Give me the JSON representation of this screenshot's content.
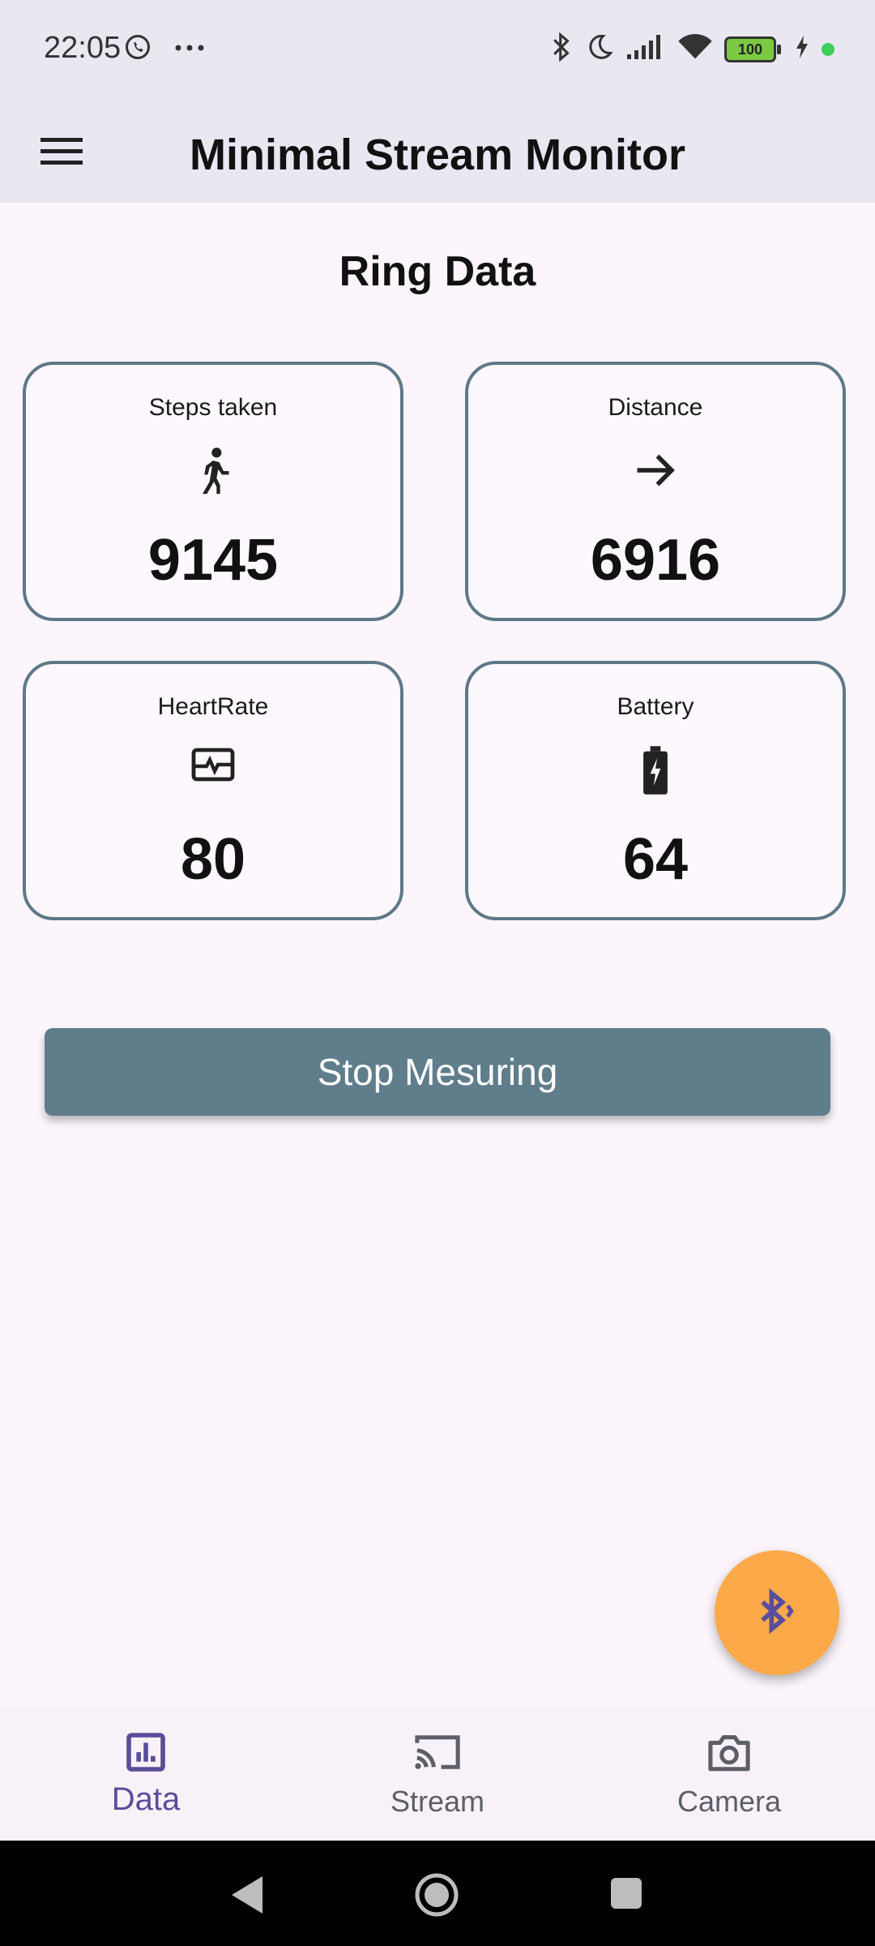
{
  "status_bar": {
    "time": "22:05",
    "battery_level": "100",
    "icons": [
      "whatsapp-icon",
      "more-icon",
      "bluetooth-icon",
      "moon-icon",
      "signal-icon",
      "wifi-icon",
      "battery-icon",
      "charging-icon",
      "green-dot"
    ]
  },
  "app_bar": {
    "title": "Minimal Stream Monitor",
    "menu_icon": "menu-icon"
  },
  "page": {
    "section_title": "Ring Data"
  },
  "cards": [
    {
      "label": "Steps taken",
      "icon": "walk-icon",
      "value": "9145"
    },
    {
      "label": "Distance",
      "icon": "arrow-right-icon",
      "value": "6916"
    },
    {
      "label": "HeartRate",
      "icon": "monitor-heart-icon",
      "value": "80"
    },
    {
      "label": "Battery",
      "icon": "battery-charging-icon",
      "value": "64"
    }
  ],
  "actions": {
    "stop_label": "Stop Mesuring",
    "fab_icon": "bluetooth-searching-icon"
  },
  "bottom_nav": {
    "items": [
      {
        "label": "Data",
        "icon": "bar-chart-icon",
        "active": true
      },
      {
        "label": "Stream",
        "icon": "cast-icon",
        "active": false
      },
      {
        "label": "Camera",
        "icon": "camera-icon",
        "active": false
      }
    ]
  },
  "colors": {
    "accent": "#5a4d9b",
    "card_border": "#5f7887",
    "button": "#5f7d8b",
    "fab": "#fcaa49",
    "bar_background": "#e9e7f0"
  }
}
